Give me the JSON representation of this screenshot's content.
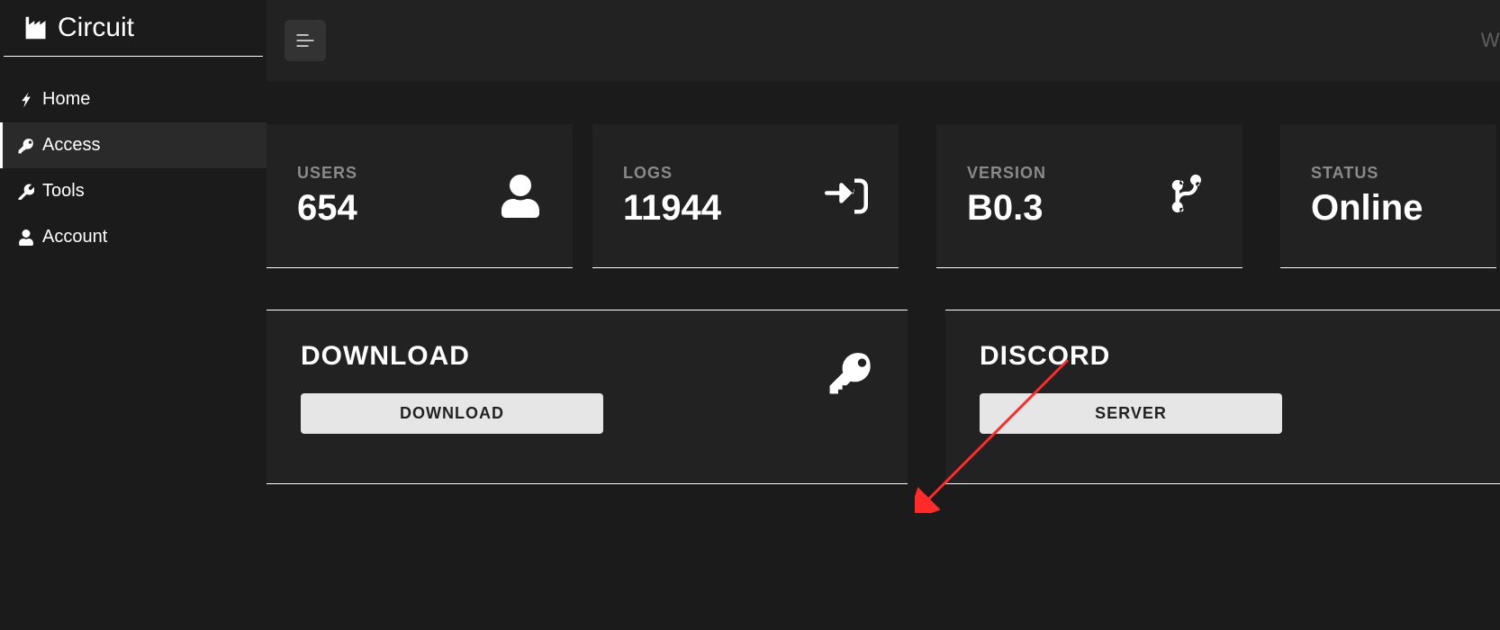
{
  "brand": {
    "name": "Circuit"
  },
  "sidebar": {
    "items": [
      {
        "label": "Home",
        "icon": "bolt",
        "active": false
      },
      {
        "label": "Access",
        "icon": "key",
        "active": true
      },
      {
        "label": "Tools",
        "icon": "wrench",
        "active": false
      },
      {
        "label": "Account",
        "icon": "user",
        "active": false
      }
    ]
  },
  "topbar": {
    "welcome": "Welcome"
  },
  "stats": {
    "users": {
      "label": "USERS",
      "value": "654"
    },
    "logs": {
      "label": "LOGS",
      "value": "11944"
    },
    "version": {
      "label": "VERSION",
      "value": "B0.3"
    },
    "status": {
      "label": "STATUS",
      "value": "Online"
    }
  },
  "panels": {
    "download": {
      "title": "DOWNLOAD",
      "button": "DOWNLOAD"
    },
    "discord": {
      "title": "DISCORD",
      "button": "SERVER"
    }
  },
  "annotation": {
    "arrow_color": "#ff2a2a"
  }
}
